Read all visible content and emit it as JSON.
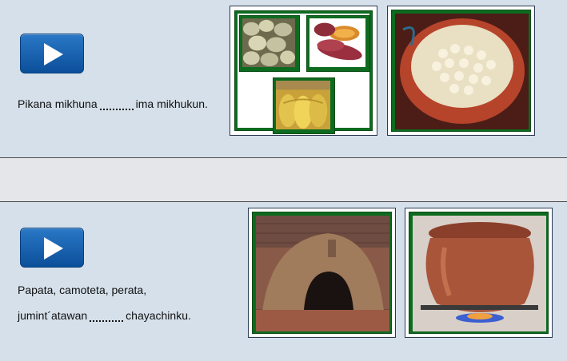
{
  "exercises": [
    {
      "play_icon": "play-icon",
      "text_before": "Pikana mikhuna",
      "text_after": "ima mikhukun.",
      "images": [
        "potatoes-image",
        "sweet-potato-image",
        "corn-cobs-image",
        "corn-bowl-image"
      ]
    },
    {
      "play_icon": "play-icon",
      "line1": "Papata, camoteta, perata,",
      "line2_before": "jumint´atawan",
      "line2_after": "chayachinku.",
      "images": [
        "clay-oven-image",
        "clay-pot-image"
      ]
    }
  ],
  "colors": {
    "card": "#d5e0ea",
    "play_button": "#1565b5",
    "frame_green": "#0e7a22"
  }
}
